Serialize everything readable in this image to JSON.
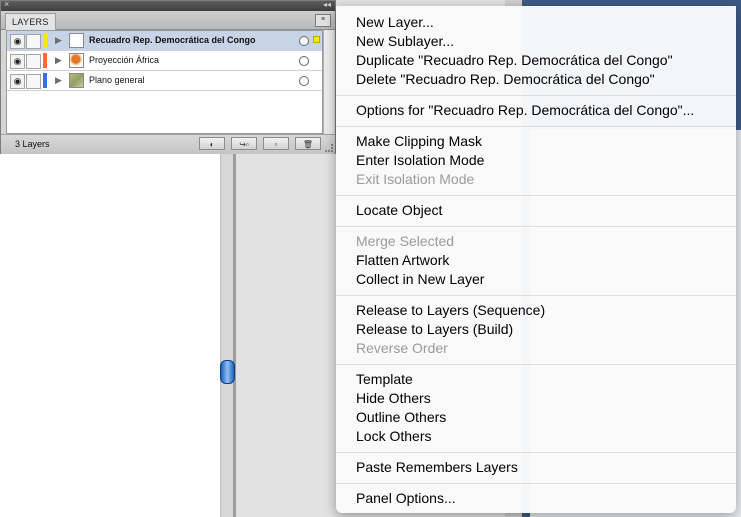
{
  "layers_panel": {
    "tab_label": "LAYERS",
    "collapse_glyph": "◂◂",
    "close_glyph": "×",
    "menu_glyph": "≡",
    "layer_count": "3 Layers",
    "layers": [
      {
        "name": "Recuadro Rep. Democrática del Congo",
        "color": "#f4e900",
        "selected": true,
        "thumbnail": "blank"
      },
      {
        "name": "Proyección África",
        "color": "#ff6a3a",
        "selected": false,
        "thumbnail": "africa-map"
      },
      {
        "name": "Plano general",
        "color": "#3b6fe0",
        "selected": false,
        "thumbnail": "general-map"
      }
    ],
    "bottom_buttons": [
      {
        "icon": "make-clipping-mask-icon",
        "glyph": "◐"
      },
      {
        "icon": "create-sublayer-icon",
        "glyph": "↪▫"
      },
      {
        "icon": "create-new-layer-icon",
        "glyph": "▫"
      },
      {
        "icon": "delete-layer-icon",
        "glyph": "🗑"
      }
    ]
  },
  "menu": {
    "groups": [
      [
        {
          "label": "New Layer...",
          "enabled": true
        },
        {
          "label": "New Sublayer...",
          "enabled": true
        },
        {
          "label": "Duplicate \"Recuadro Rep. Democrática del Congo\"",
          "enabled": true
        },
        {
          "label": "Delete \"Recuadro Rep. Democrática del Congo\"",
          "enabled": true
        }
      ],
      [
        {
          "label": "Options for \"Recuadro Rep. Democrática del Congo\"...",
          "enabled": true
        }
      ],
      [
        {
          "label": "Make Clipping Mask",
          "enabled": true
        },
        {
          "label": "Enter Isolation Mode",
          "enabled": true
        },
        {
          "label": "Exit Isolation Mode",
          "enabled": false
        }
      ],
      [
        {
          "label": "Locate Object",
          "enabled": true
        }
      ],
      [
        {
          "label": "Merge Selected",
          "enabled": false
        },
        {
          "label": "Flatten Artwork",
          "enabled": true
        },
        {
          "label": "Collect in New Layer",
          "enabled": true
        }
      ],
      [
        {
          "label": "Release to Layers (Sequence)",
          "enabled": true
        },
        {
          "label": "Release to Layers (Build)",
          "enabled": true
        },
        {
          "label": "Reverse Order",
          "enabled": false
        }
      ],
      [
        {
          "label": "Template",
          "enabled": true
        },
        {
          "label": "Hide Others",
          "enabled": true
        },
        {
          "label": "Outline Others",
          "enabled": true
        },
        {
          "label": "Lock Others",
          "enabled": true
        }
      ],
      [
        {
          "label": "Paste Remembers Layers",
          "enabled": true
        }
      ],
      [
        {
          "label": "Panel Options...",
          "enabled": true
        }
      ]
    ]
  }
}
